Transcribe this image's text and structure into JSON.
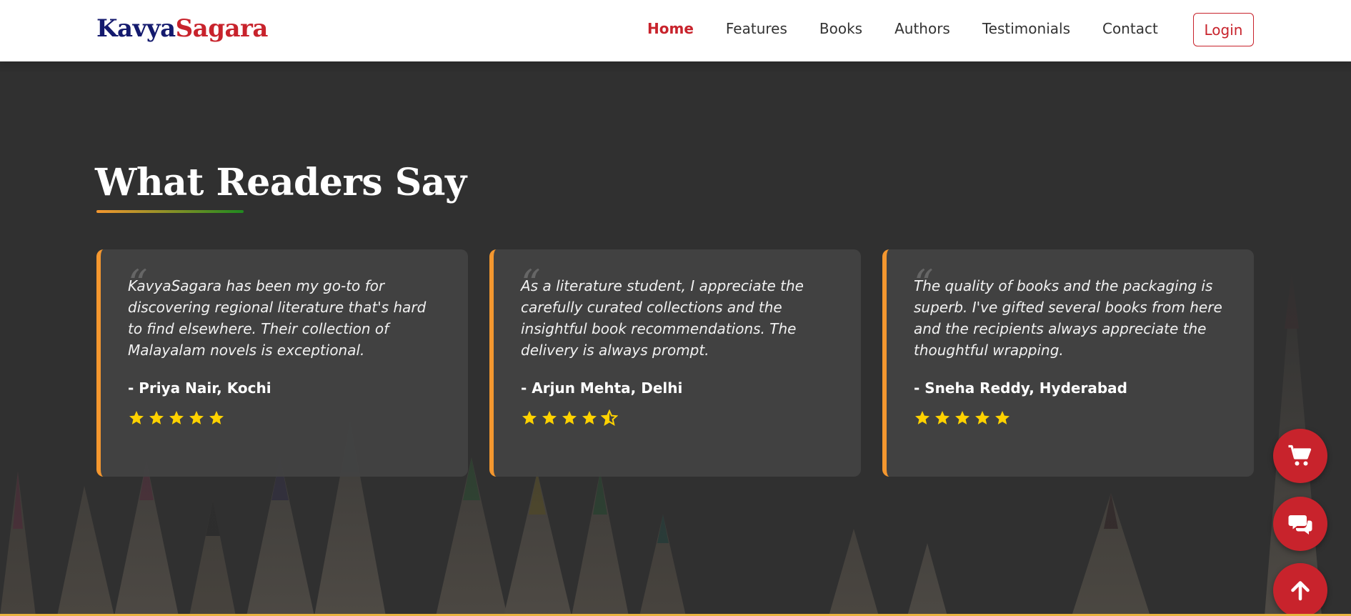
{
  "brand": {
    "part1": "Kavya",
    "part2": "Sagara"
  },
  "nav": {
    "items": [
      "Home",
      "Features",
      "Books",
      "Authors",
      "Testimonials",
      "Contact"
    ],
    "active": "Home",
    "login_label": "Login"
  },
  "section": {
    "title": "What Readers Say"
  },
  "testimonials": [
    {
      "text": "KavyaSagara has been my go-to for discovering regional literature that's hard to find elsewhere. Their collection of Malayalam novels is exceptional.",
      "author": "- Priya Nair, Kochi",
      "rating": 5
    },
    {
      "text": "As a literature student, I appreciate the carefully curated collections and the insightful book recommendations. The delivery is always prompt.",
      "author": "- Arjun Mehta, Delhi",
      "rating": 4.5
    },
    {
      "text": "The quality of books and the packaging is superb. I've gifted several books from here and the recipients always appreciate the thoughtful wrapping.",
      "author": "- Sneha Reddy, Hyderabad",
      "rating": 5
    }
  ],
  "floating_buttons": [
    "cart-icon",
    "chat-icon",
    "arrow-up-icon"
  ],
  "colors": {
    "brand_navy": "#141a6e",
    "brand_red": "#c8232c",
    "accent_orange": "#f4972f",
    "accent_green": "#1f8a1f",
    "star_yellow": "#ffd200",
    "section_bg": "#303030",
    "card_bg": "#424242"
  }
}
